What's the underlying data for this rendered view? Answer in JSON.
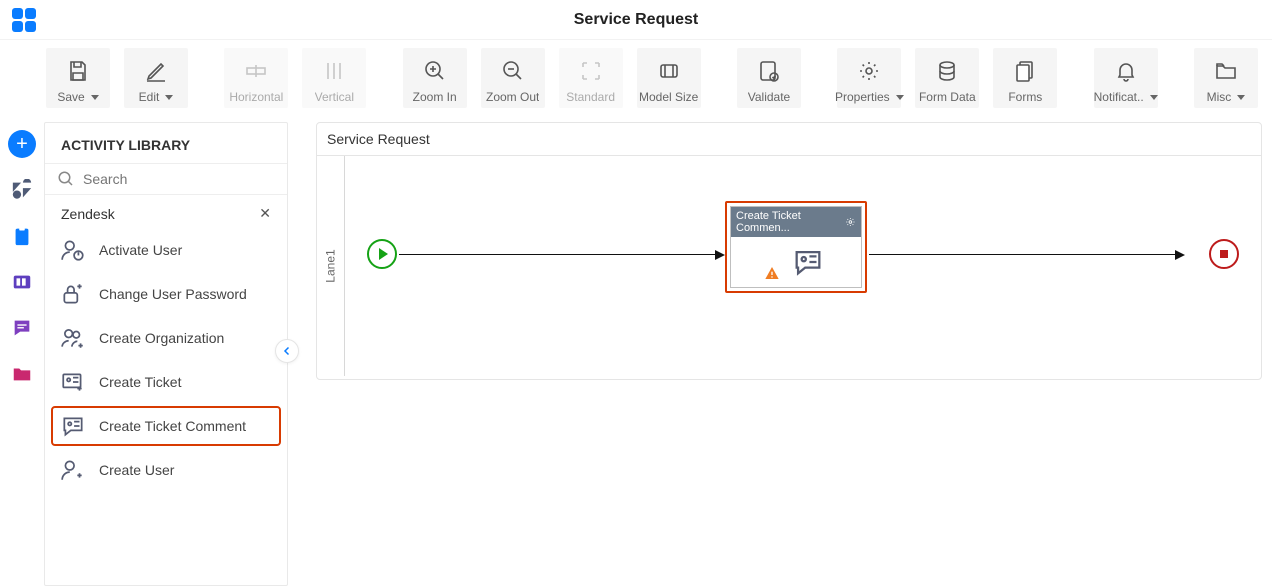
{
  "header": {
    "title": "Service Request"
  },
  "toolbar": {
    "save": "Save",
    "edit": "Edit",
    "horizontal": "Horizontal",
    "vertical": "Vertical",
    "zoom_in": "Zoom In",
    "zoom_out": "Zoom Out",
    "standard": "Standard",
    "model_size": "Model Size",
    "validate": "Validate",
    "properties": "Properties",
    "form_data": "Form Data",
    "forms": "Forms",
    "notifications": "Notificat..",
    "misc": "Misc"
  },
  "side": {
    "header": "ACTIVITY LIBRARY",
    "search_placeholder": "Search",
    "group": "Zendesk",
    "items": [
      {
        "label": "Activate User"
      },
      {
        "label": "Change User Password"
      },
      {
        "label": "Create Organization"
      },
      {
        "label": "Create Ticket"
      },
      {
        "label": "Create Ticket Comment",
        "selected": true
      },
      {
        "label": "Create User"
      }
    ]
  },
  "canvas": {
    "title": "Service Request",
    "lane": "Lane1",
    "activity_title": "Create Ticket Commen..."
  },
  "icons": {
    "search": "search-icon",
    "gear": "gear-icon"
  }
}
